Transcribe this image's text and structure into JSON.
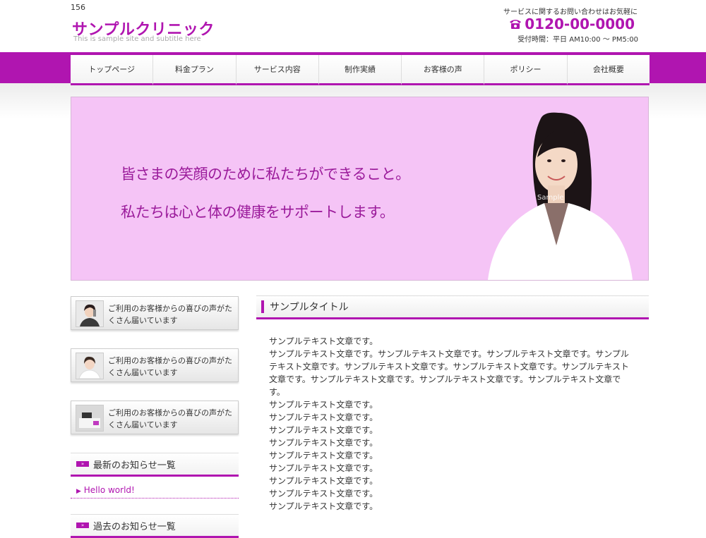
{
  "header": {
    "page_number": "156",
    "title": "サンプルクリニック",
    "subtitle": "This is sample site and subtitle here",
    "contact_note": "サービスに関するお問い合わせはお気軽に",
    "phone": "0120-00-0000",
    "hours": "受付時間：平日 AM10:00 ～ PM5:00"
  },
  "nav": {
    "items": [
      "トップページ",
      "料金プラン",
      "サービス内容",
      "制作実績",
      "お客様の声",
      "ポリシー",
      "会社概要"
    ]
  },
  "hero": {
    "line1": "皆さまの笑顔のために私たちができること。",
    "line2": "私たちは心と体の健康をサポートします。",
    "sample_watermark": "Sample"
  },
  "sidebar": {
    "promos": [
      {
        "text": "ご利用のお客様からの喜びの声がたくさん届いています",
        "icon": "phone-woman-avatar-icon"
      },
      {
        "text": "ご利用のお客様からの喜びの声がたくさん届いています",
        "icon": "smiling-woman-avatar-icon"
      },
      {
        "text": "ご利用のお客様からの喜びの声がたくさん届いています",
        "icon": "desk-phone-avatar-icon"
      }
    ],
    "news_heading": "最新のお知らせ一覧",
    "news_items": [
      "Hello world!"
    ],
    "archive_heading": "過去のお知らせ一覧"
  },
  "main": {
    "heading": "サンプルタイトル",
    "paragraphs": [
      "サンプルテキスト文章です。",
      "サンプルテキスト文章です。サンプルテキスト文章です。サンプルテキスト文章です。サンプルテキスト文章です。サンプルテキスト文章です。サンプルテキスト文章です。サンプルテキスト文章です。サンプルテキスト文章です。サンプルテキスト文章です。サンプルテキスト文章です。",
      "サンプルテキスト文章です。",
      "サンプルテキスト文章です。",
      "サンプルテキスト文章です。",
      "サンプルテキスト文章です。",
      "サンプルテキスト文章です。",
      "サンプルテキスト文章です。",
      "サンプルテキスト文章です。",
      "サンプルテキスト文章です。",
      "サンプルテキスト文章です。"
    ]
  },
  "colors": {
    "accent": "#b015b0",
    "hero_background": "#f5c4f6",
    "hero_text": "#9b1b9b"
  }
}
